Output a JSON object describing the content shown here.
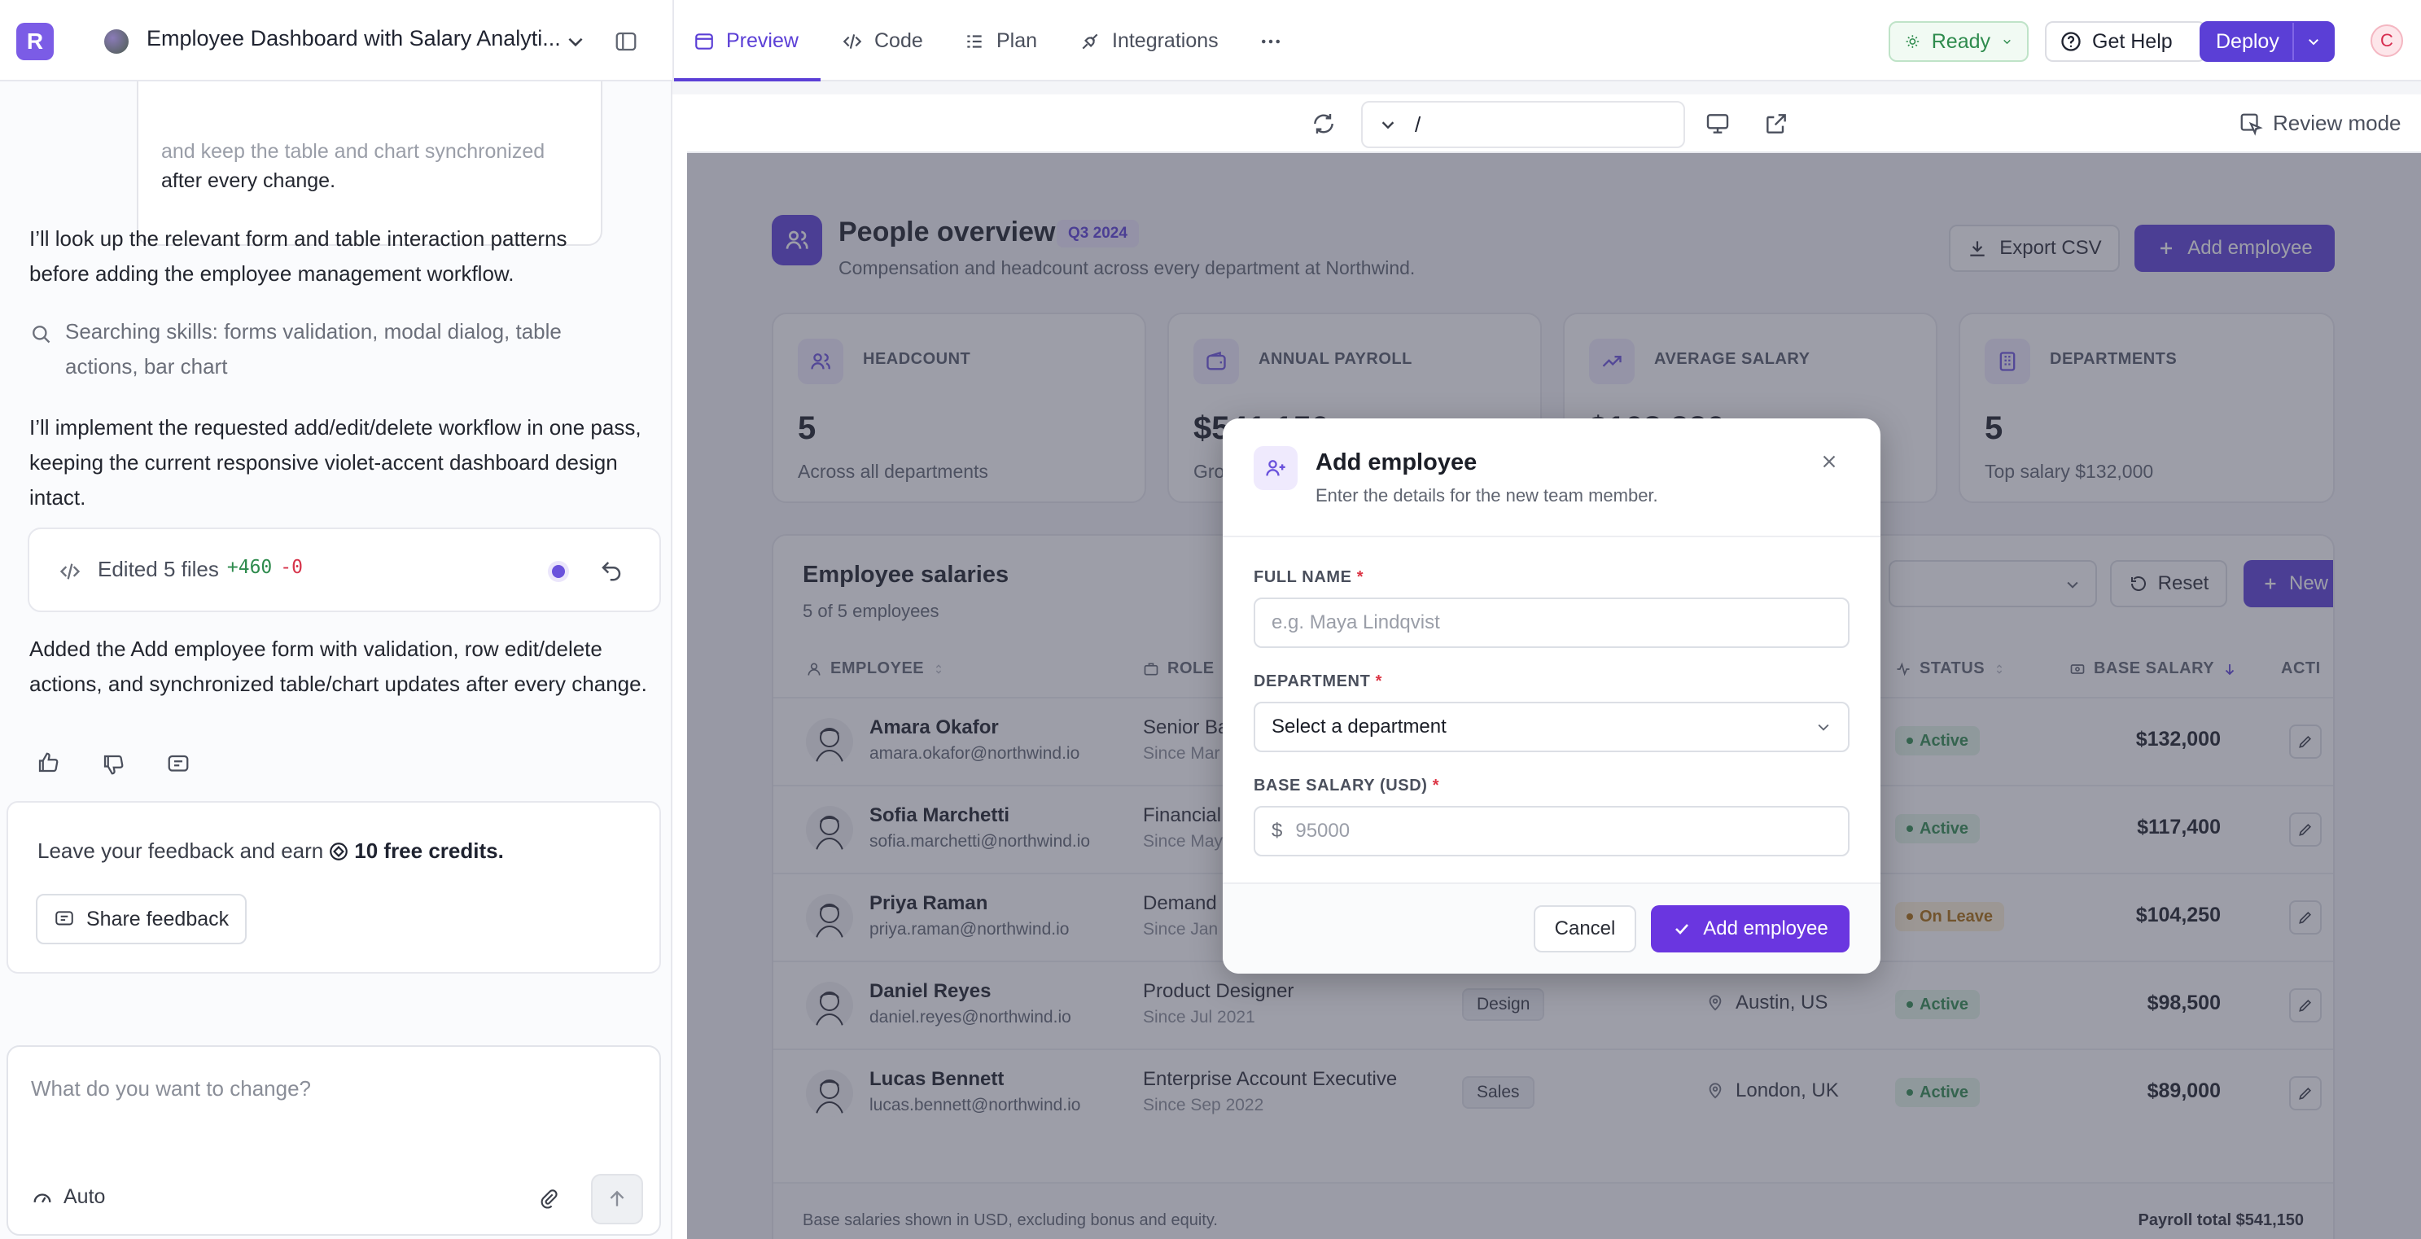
{
  "app": {
    "logo_letter": "R",
    "project_title": "Employee Dashboard with Salary Analyti...",
    "tabs": [
      {
        "label": "Preview",
        "active": true
      },
      {
        "label": "Code"
      },
      {
        "label": "Plan"
      },
      {
        "label": "Integrations"
      }
    ],
    "status_label": "Ready",
    "help_label": "Get Help",
    "deploy_label": "Deploy",
    "avatar_letter": "C",
    "accent": "#5b3fd6"
  },
  "chat": {
    "bubble_tail_line1": "and keep the table and chart synchronized",
    "bubble_tail_line2": "after every change.",
    "msg1": "I’ll look up the relevant form and table interaction patterns before adding the employee management workflow.",
    "tool_text": "Searching skills: forms validation, modal dialog, table actions, bar chart",
    "msg2": "I’ll implement the requested add/edit/delete workflow in one pass, keeping the current responsive violet-accent dashboard design intact.",
    "files_label": "Edited 5 files",
    "additions": "+460",
    "deletions": "-0",
    "msg3": "Added the Add employee form with validation, row edit/delete actions, and synchronized table/chart updates after every change.",
    "feedback_text": "Leave your feedback and earn",
    "feedback_credits": "10 free credits.",
    "share_feedback": "Share feedback",
    "composer_placeholder": "What do you want to change?",
    "mode_label": "Auto"
  },
  "preview_bar": {
    "path": "/",
    "review_mode": "Review mode"
  },
  "dashboard": {
    "title": "People overview",
    "period_badge": "Q3 2024",
    "subtitle": "Compensation and headcount across every department at Northwind.",
    "export_label": "Export CSV",
    "add_label": "Add employee",
    "kpis": [
      {
        "label": "HEADCOUNT",
        "value": "5",
        "sub": "Across all departments"
      },
      {
        "label": "ANNUAL PAYROLL",
        "value": "$541,150",
        "sub": "Gro"
      },
      {
        "label": "AVERAGE SALARY",
        "value": "$108,230",
        "sub": ""
      },
      {
        "label": "DEPARTMENTS",
        "value": "5",
        "sub": "Top salary $132,000"
      }
    ],
    "table": {
      "title": "Employee salaries",
      "count": "5 of 5 employees",
      "reset_label": "Reset",
      "new_label": "New",
      "headers": {
        "employee": "EMPLOYEE",
        "role": "ROLE",
        "status": "STATUS",
        "salary": "BASE SALARY",
        "actions": "ACTI"
      },
      "rows": [
        {
          "name": "Amara Okafor",
          "email": "amara.okafor@northwind.io",
          "role": "Senior Ba",
          "since": "Since Mar",
          "dept": "",
          "location": "",
          "status": "Active",
          "salary": "$132,000"
        },
        {
          "name": "Sofia Marchetti",
          "email": "sofia.marchetti@northwind.io",
          "role": "Financial",
          "since": "Since May",
          "dept": "",
          "location": "",
          "status": "Active",
          "salary": "$117,400"
        },
        {
          "name": "Priya Raman",
          "email": "priya.raman@northwind.io",
          "role": "Demand",
          "since": "Since Jan",
          "dept": "",
          "location": "",
          "status": "On Leave",
          "salary": "$104,250"
        },
        {
          "name": "Daniel Reyes",
          "email": "daniel.reyes@northwind.io",
          "role": "Product Designer",
          "since": "Since Jul 2021",
          "dept": "Design",
          "location": "Austin, US",
          "status": "Active",
          "salary": "$98,500"
        },
        {
          "name": "Lucas Bennett",
          "email": "lucas.bennett@northwind.io",
          "role": "Enterprise Account Executive",
          "since": "Since Sep 2022",
          "dept": "Sales",
          "location": "London, UK",
          "status": "Active",
          "salary": "$89,000"
        }
      ],
      "footnote": "Base salaries shown in USD, excluding bonus and equity.",
      "payroll_total": "Payroll total $541,150"
    }
  },
  "modal": {
    "title": "Add employee",
    "subtitle": "Enter the details for the new team member.",
    "fullname_label": "FULL NAME",
    "fullname_placeholder": "e.g. Maya Lindqvist",
    "department_label": "DEPARTMENT",
    "department_value": "Select a department",
    "salary_label": "BASE SALARY (USD)",
    "currency_prefix": "$",
    "salary_placeholder": "95000",
    "required_mark": "*",
    "cancel_label": "Cancel",
    "submit_label": "Add employee"
  }
}
